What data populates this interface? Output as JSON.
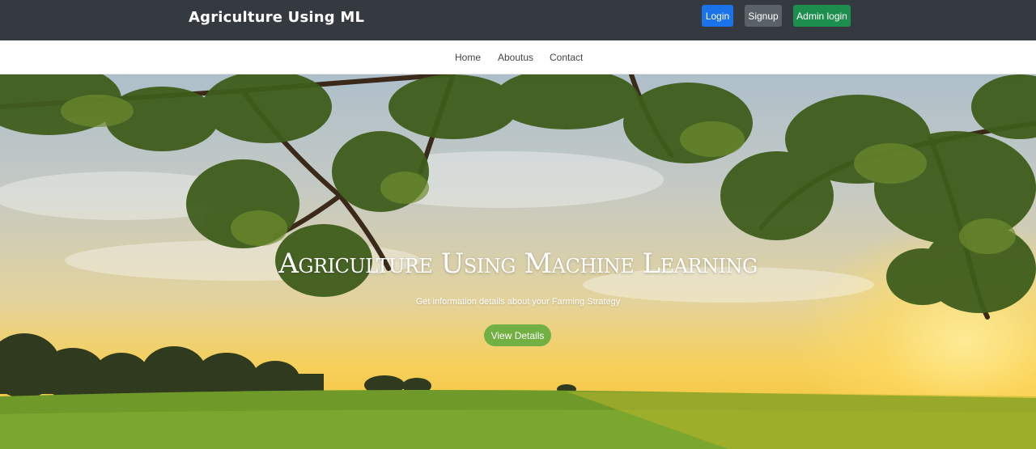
{
  "header": {
    "brand": "Agriculture Using ML",
    "login_label": "Login",
    "signup_label": "Signup",
    "admin_login_label": "Admin login"
  },
  "nav": {
    "items": [
      {
        "label": "Home"
      },
      {
        "label": "Aboutus"
      },
      {
        "label": "Contact"
      }
    ]
  },
  "hero": {
    "title": "Agriculture Using Machine Learning",
    "subtitle": "Get information details about your Farming Strategy",
    "button_label": "View Details"
  },
  "colors": {
    "topbar": "#343a40",
    "login_button": "#1a73e8",
    "signup_button": "#5a6268",
    "admin_button": "#1e8e4e",
    "hero_button": "#72b043"
  }
}
